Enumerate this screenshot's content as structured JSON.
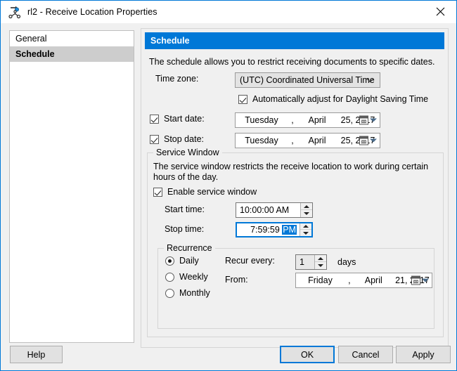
{
  "window": {
    "title": "rl2 - Receive Location Properties",
    "icon": "receive-location-icon",
    "close_label": "✕",
    "accent_color": "#0078d7"
  },
  "nav": {
    "items": [
      {
        "label": "General",
        "selected": false
      },
      {
        "label": "Schedule",
        "selected": true
      }
    ]
  },
  "panel": {
    "header": "Schedule",
    "description": "The schedule allows you to restrict receiving documents to specific dates.",
    "timezone": {
      "label": "Time zone:",
      "value": "(UTC) Coordinated Universal Time"
    },
    "dst": {
      "label": "Automatically adjust for Daylight Saving Time",
      "checked": true
    },
    "start_date": {
      "label": "Start date:",
      "checked": true,
      "day": "Tuesday",
      "comma": ",",
      "month": "April",
      "rest": "25, 2017"
    },
    "stop_date": {
      "label": "Stop date:",
      "checked": true,
      "day": "Tuesday",
      "comma": ",",
      "month": "April",
      "rest": "25, 2017"
    }
  },
  "service_window": {
    "title": "Service Window",
    "description": "The service window restricts the receive location to work during certain hours of the day.",
    "enable": {
      "label": "Enable service window",
      "checked": true
    },
    "start_time": {
      "label": "Start time:",
      "value": "10:00:00 AM"
    },
    "stop_time": {
      "label": "Stop time:",
      "value_prefix": "7:59:59 ",
      "value_selected": "PM",
      "focused": true
    }
  },
  "recurrence": {
    "title": "Recurrence",
    "options": [
      {
        "label": "Daily",
        "selected": true
      },
      {
        "label": "Weekly",
        "selected": false
      },
      {
        "label": "Monthly",
        "selected": false
      }
    ],
    "recur_every": {
      "label": "Recur every:",
      "value": "1",
      "unit": "days"
    },
    "from": {
      "label": "From:",
      "day": "Friday",
      "comma": ",",
      "month": "April",
      "rest": "21, 2017"
    }
  },
  "footer": {
    "help": "Help",
    "ok": "OK",
    "cancel": "Cancel",
    "apply": "Apply"
  }
}
